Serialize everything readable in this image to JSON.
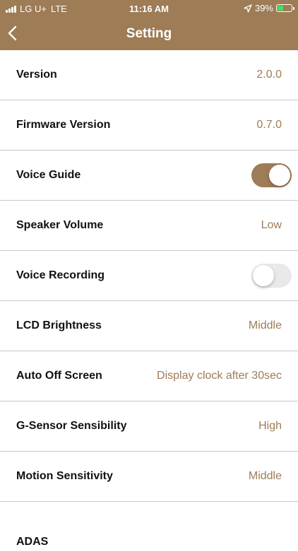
{
  "status_bar": {
    "carrier": "LG U+",
    "network": "LTE",
    "time": "11:16 AM",
    "battery": "39%"
  },
  "header": {
    "title": "Setting"
  },
  "colors": {
    "accent": "#9d7c56",
    "toggle_off": "#e9e9ea"
  },
  "settings": [
    {
      "label": "Version",
      "value": "2.0.0"
    },
    {
      "label": "Firmware Version",
      "value": "0.7.0"
    },
    {
      "label": "Voice Guide",
      "toggle": true
    },
    {
      "label": "Speaker Volume",
      "value": "Low"
    },
    {
      "label": "Voice Recording",
      "toggle": false
    },
    {
      "label": "LCD Brightness",
      "value": "Middle"
    },
    {
      "label": "Auto Off Screen",
      "value": "Display clock after 30sec"
    },
    {
      "label": "G-Sensor Sensibility",
      "value": "High"
    },
    {
      "label": "Motion Sensitivity",
      "value": "Middle"
    },
    {
      "label": "ADAS",
      "value": ""
    }
  ]
}
